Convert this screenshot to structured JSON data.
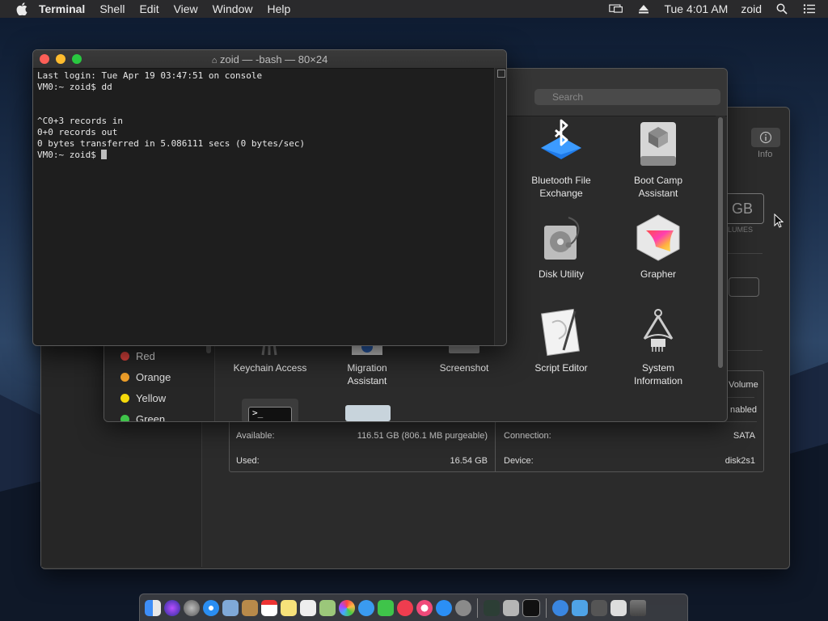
{
  "menubar": {
    "app_name": "Terminal",
    "menus": [
      "Shell",
      "Edit",
      "View",
      "Window",
      "Help"
    ],
    "clock": "Tue 4:01 AM",
    "user": "zoid"
  },
  "terminal": {
    "title": "zoid — -bash — 80×24",
    "lines": [
      "Last login: Tue Apr 19 03:47:51 on console",
      "VM0:~ zoid$ dd",
      "",
      "",
      "^C0+3 records in",
      "0+0 records out",
      "0 bytes transferred in 5.086111 secs (0 bytes/sec)",
      "VM0:~ zoid$ "
    ]
  },
  "finder": {
    "search_placeholder": "Search",
    "tags": [
      "Red",
      "Orange",
      "Yellow",
      "Green"
    ],
    "tag_colors": [
      "#e0443e",
      "#f0a02a",
      "#f5d90a",
      "#3fc44a"
    ],
    "apps": [
      {
        "label1": "Bluetooth File",
        "label2": "Exchange",
        "icon": "bluetooth-icon"
      },
      {
        "label1": "Boot Camp",
        "label2": "Assistant",
        "icon": "boot-camp-icon"
      },
      {
        "label1": "Disk Utility",
        "label2": "",
        "icon": "disk-utility-icon"
      },
      {
        "label1": "Grapher",
        "label2": "",
        "icon": "grapher-icon"
      },
      {
        "label1": "Keychain Access",
        "label2": "",
        "icon": "keychain-icon"
      },
      {
        "label1": "Migration",
        "label2": "Assistant",
        "icon": "migration-icon"
      },
      {
        "label1": "Screenshot",
        "label2": "",
        "icon": "screenshot-icon"
      },
      {
        "label1": "Script Editor",
        "label2": "",
        "icon": "script-editor-icon"
      },
      {
        "label1": "System",
        "label2": "Information",
        "icon": "system-information-icon"
      }
    ]
  },
  "disk_utility": {
    "info_label": "Info",
    "size_box": "GB",
    "volumes_label": "OLUMES",
    "right_partial_1": "Volume",
    "right_partial_2": "nabled",
    "rows": {
      "available_label": "Available:",
      "available_value": "116.51 GB (806.1 MB purgeable)",
      "used_label": "Used:",
      "used_value": "16.54 GB",
      "connection_label": "Connection:",
      "connection_value": "SATA",
      "device_label": "Device:",
      "device_value": "disk2s1"
    }
  }
}
